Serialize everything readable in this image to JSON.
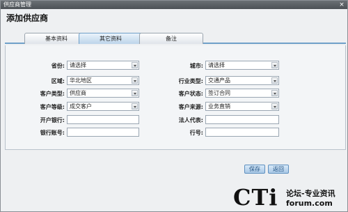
{
  "window": {
    "title": "供应商管理",
    "close_glyph": "×"
  },
  "heading": "添加供应商",
  "tabs": [
    {
      "label": "基本资料",
      "active": false
    },
    {
      "label": "其它资料",
      "active": true
    },
    {
      "label": "备注",
      "active": false
    }
  ],
  "form": {
    "province": {
      "label": "省份:",
      "value": "请选择"
    },
    "city": {
      "label": "城市:",
      "value": "请选择"
    },
    "region": {
      "label": "区域:",
      "value": "华北地区"
    },
    "industry": {
      "label": "行业类型:",
      "value": "交通产品"
    },
    "client_type": {
      "label": "客户类型:",
      "value": "供应商"
    },
    "client_status": {
      "label": "客户状态:",
      "value": "签订合同"
    },
    "client_level": {
      "label": "客户等级:",
      "value": "成交客户"
    },
    "client_source": {
      "label": "客户来源:",
      "value": "业务直销"
    },
    "bank": {
      "label": "开户银行:",
      "value": ""
    },
    "legal_rep": {
      "label": "法人代表:",
      "value": ""
    },
    "bank_account": {
      "label": "银行账号:",
      "value": ""
    },
    "tax_no": {
      "label": "行号:",
      "value": ""
    }
  },
  "buttons": {
    "save": "保存",
    "back": "返回"
  },
  "watermark": {
    "brand": "CTi",
    "tagline": "论坛-专业资讯",
    "domain": "forum.com"
  }
}
